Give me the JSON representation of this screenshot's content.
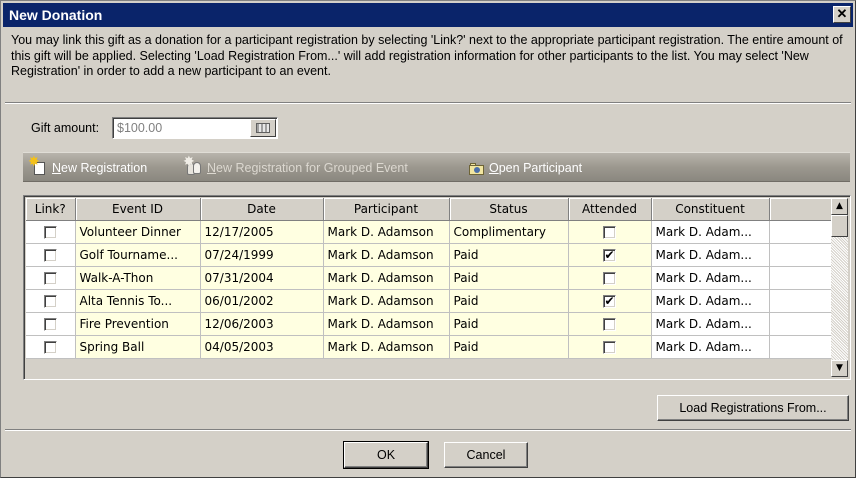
{
  "window": {
    "title": "New Donation",
    "close_glyph": "✕"
  },
  "description": "You may link this gift as a donation for a participant registration by selecting 'Link?' next to the appropriate participant registration. The entire amount of this gift will be applied.  Selecting 'Load Registration From...' will add registration information for other participants to the list.  You may select 'New Registration' in order to add a new participant to an event.",
  "gift": {
    "label": "Gift amount:",
    "value": "$100.00",
    "calc_icon": "calculator-icon"
  },
  "toolbar": {
    "new_registration": {
      "label": "New Registration",
      "icon": "new-record-icon",
      "enabled": true
    },
    "new_grouped": {
      "label": "New Registration for Grouped Event",
      "icon": "group-icon",
      "enabled": false
    },
    "open_participant": {
      "label": "Open Participant",
      "icon": "folder-person-icon",
      "enabled": true
    }
  },
  "grid": {
    "columns": [
      "Link?",
      "Event ID",
      "Date",
      "Participant",
      "Status",
      "Attended",
      "Constituent",
      ""
    ],
    "rows": [
      {
        "link": false,
        "event_id": "Volunteer Dinner",
        "date": "12/17/2005",
        "participant": "Mark D. Adamson",
        "status": "Complimentary",
        "attended": false,
        "constituent": "Mark D. Adam..."
      },
      {
        "link": false,
        "event_id": "Golf Tourname...",
        "date": "07/24/1999",
        "participant": "Mark D. Adamson",
        "status": "Paid",
        "attended": true,
        "constituent": "Mark D. Adam..."
      },
      {
        "link": false,
        "event_id": "Walk-A-Thon",
        "date": "07/31/2004",
        "participant": "Mark D. Adamson",
        "status": "Paid",
        "attended": false,
        "constituent": "Mark D. Adam..."
      },
      {
        "link": false,
        "event_id": "Alta Tennis To...",
        "date": "06/01/2002",
        "participant": "Mark D. Adamson",
        "status": "Paid",
        "attended": true,
        "constituent": "Mark D. Adam..."
      },
      {
        "link": false,
        "event_id": "Fire Prevention",
        "date": "12/06/2003",
        "participant": "Mark D. Adamson",
        "status": "Paid",
        "attended": false,
        "constituent": "Mark D. Adam..."
      },
      {
        "link": false,
        "event_id": "Spring Ball",
        "date": "04/05/2003",
        "participant": "Mark D. Adamson",
        "status": "Paid",
        "attended": false,
        "constituent": "Mark D. Adam..."
      }
    ],
    "check_glyph": "✔"
  },
  "buttons": {
    "load_registrations": "Load Registrations From...",
    "ok": "OK",
    "cancel": "Cancel"
  },
  "colors": {
    "titlebar": "#0a246a",
    "dialog": "#d4d0c8",
    "cell_highlight": "#ffffe1"
  }
}
